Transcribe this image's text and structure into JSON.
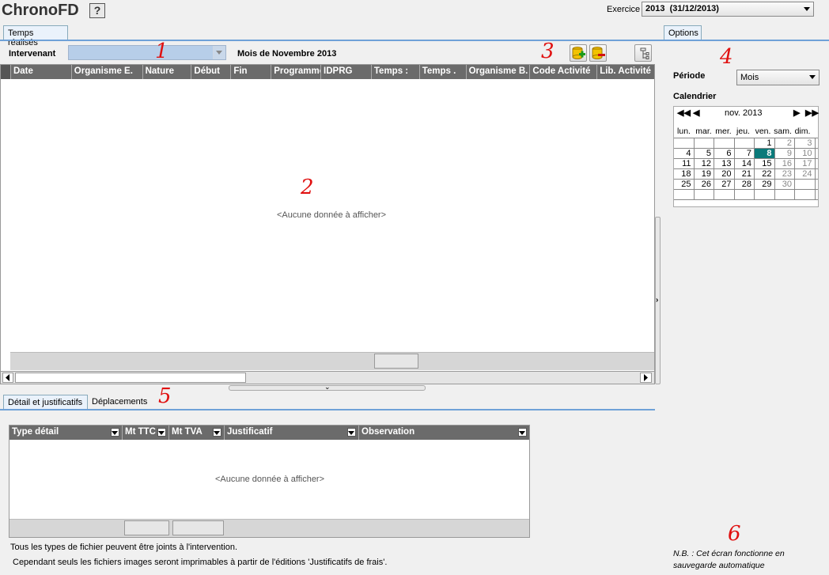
{
  "app": {
    "title": "ChronoFD",
    "help_label": "?"
  },
  "exercice": {
    "label": "Exercice",
    "value": "2013  (31/12/2013)"
  },
  "main_tab": {
    "label": "Temps réalisés"
  },
  "options_tab": {
    "label": "Options"
  },
  "intervenant": {
    "label": "Intervenant",
    "value": ""
  },
  "month_label": "Mois de Novembre 2013",
  "grid": {
    "columns": [
      "Date",
      "Organisme E.",
      "Nature",
      "Début",
      "Fin",
      "Programme",
      "IDPRG",
      "Temps :",
      "Temps .",
      "Organisme B.",
      "Code Activité",
      "Lib. Activité"
    ],
    "empty_text": "<Aucune donnée à afficher>"
  },
  "annotations": [
    "1",
    "2",
    "3",
    "4",
    "5",
    "6"
  ],
  "options": {
    "periode_label": "Période",
    "periode_value": "Mois",
    "calendrier_label": "Calendrier",
    "calendar": {
      "month_label": "nov. 2013",
      "weekdays": [
        "lun.",
        "mar.",
        "mer.",
        "jeu.",
        "ven.",
        "sam.",
        "dim."
      ],
      "rows": [
        [
          "",
          "",
          "",
          "",
          "1",
          "2",
          "3"
        ],
        [
          "4",
          "5",
          "6",
          "7",
          "8",
          "9",
          "10"
        ],
        [
          "11",
          "12",
          "13",
          "14",
          "15",
          "16",
          "17"
        ],
        [
          "18",
          "19",
          "20",
          "21",
          "22",
          "23",
          "24"
        ],
        [
          "25",
          "26",
          "27",
          "28",
          "29",
          "30",
          ""
        ],
        [
          "",
          "",
          "",
          "",
          "",
          "",
          ""
        ]
      ],
      "selected_day": "8"
    }
  },
  "bottom_tabs": [
    {
      "label": "Détail et justificatifs"
    },
    {
      "label": "Déplacements"
    }
  ],
  "detail_grid": {
    "columns": [
      "Type détail",
      "Mt TTC",
      "Mt TVA",
      "Justificatif",
      "Observation"
    ],
    "empty_text": "<Aucune donnée à afficher>"
  },
  "footer_notes": [
    "Tous les types de fichier peuvent être joints à l'intervention.",
    "Cependant seuls les fichiers images seront imprimables à partir de l'éditions 'Justificatifs de frais'."
  ],
  "nb_note": [
    "N.B. : Cet écran fonctionne en",
    "sauvegarde automatique"
  ]
}
